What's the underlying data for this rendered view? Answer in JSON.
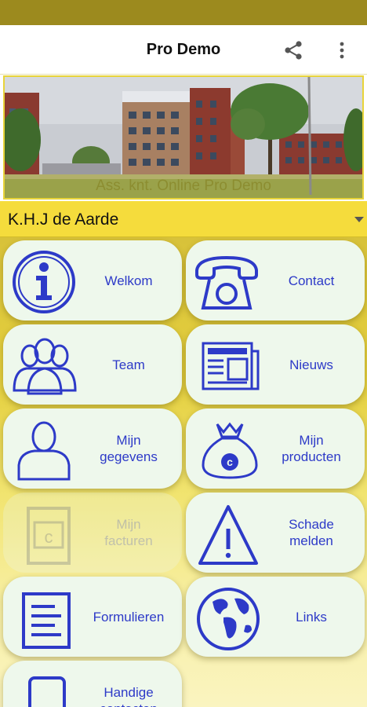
{
  "app": {
    "title": "Pro Demo"
  },
  "toolbar": {
    "share_icon": "share-icon",
    "more_icon": "more-vert-icon"
  },
  "banner": {
    "caption": "Ass. knt. Online Pro Demo"
  },
  "selector": {
    "value": "K.H.J de Aarde"
  },
  "colors": {
    "accent": "#2d3ac8",
    "brand_yellow": "#f5dc3c",
    "tile_bg": "#eef8ec"
  },
  "tiles": [
    {
      "line1": "Welkom",
      "line2": "",
      "icon": "info-icon"
    },
    {
      "line1": "Contact",
      "line2": "",
      "icon": "telephone-icon"
    },
    {
      "line1": "Team",
      "line2": "",
      "icon": "team-icon"
    },
    {
      "line1": "Nieuws",
      "line2": "",
      "icon": "newspaper-icon"
    },
    {
      "line1": "Mijn",
      "line2": "gegevens",
      "icon": "person-icon"
    },
    {
      "line1": "Mijn",
      "line2": "producten",
      "icon": "money-bag-icon"
    },
    {
      "line1": "Mijn",
      "line2": "facturen",
      "icon": "invoice-icon",
      "disabled": true
    },
    {
      "line1": "Schade",
      "line2": "melden",
      "icon": "warning-icon"
    },
    {
      "line1": "Formulieren",
      "line2": "",
      "icon": "form-icon"
    },
    {
      "line1": "Links",
      "line2": "",
      "icon": "globe-icon"
    },
    {
      "line1": "Handige",
      "line2": "contacten",
      "icon": "phone-device-icon"
    }
  ]
}
